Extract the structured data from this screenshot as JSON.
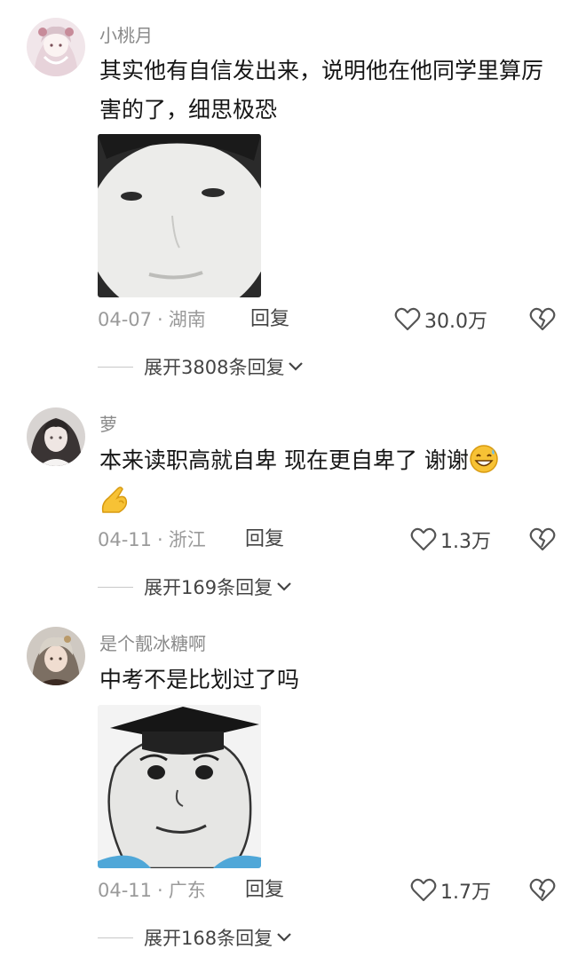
{
  "comments": [
    {
      "username": "小桃月",
      "text": "其实他有自信发出来，说明他在他同学里算厉害的了，细思极恐",
      "date": "04-07",
      "location": "湖南",
      "reply_label": "回复",
      "likes": "30.0万",
      "expand_label": "展开3808条回复",
      "avatar_icon": "anime-girl-avatar",
      "sticker": "blank-face-meme-sticker"
    },
    {
      "username": "萝",
      "text": "本来读职高就自卑 现在更自卑了 谢谢",
      "emoji": [
        "grinning-sweat-emoji",
        "ok-hand-emoji"
      ],
      "date": "04-11",
      "location": "浙江",
      "reply_label": "回复",
      "likes": "1.3万",
      "expand_label": "展开169条回复",
      "avatar_icon": "dark-hair-girl-avatar"
    },
    {
      "username": "是个靓冰糖啊",
      "text": "中考不是比划过了吗",
      "date": "04-11",
      "location": "广东",
      "reply_label": "回复",
      "likes": "1.7万",
      "expand_label": "展开168条回复",
      "avatar_icon": "anime-boy-avatar",
      "sticker": "graduation-cap-face-meme-sticker"
    }
  ],
  "colors": {
    "text": "#161616",
    "muted": "#9a9a9a",
    "username": "#8a8a8a"
  }
}
